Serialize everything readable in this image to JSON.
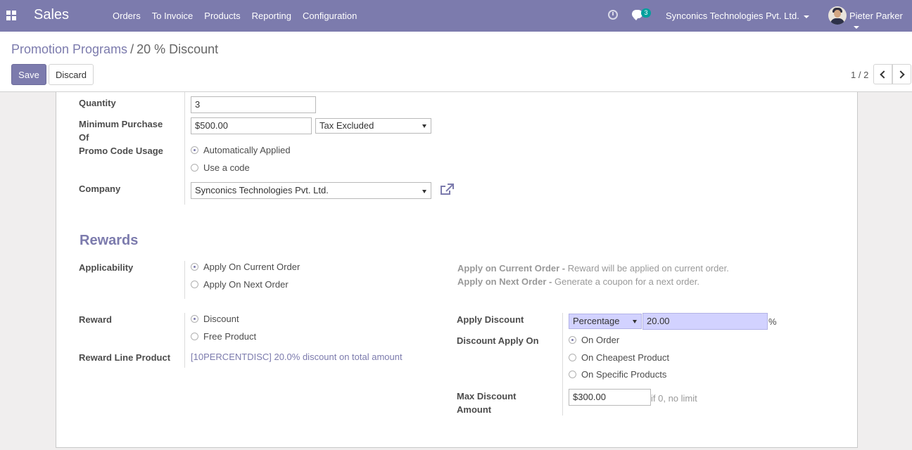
{
  "navbar": {
    "brand": "Sales",
    "menu": [
      "Orders",
      "To Invoice",
      "Products",
      "Reporting",
      "Configuration"
    ],
    "message_count": "3",
    "company": "Synconics Technologies Pvt. Ltd.",
    "user": "Pieter Parker"
  },
  "breadcrumb": {
    "parent": "Promotion Programs",
    "separator": "/",
    "current": "20 % Discount"
  },
  "toolbar": {
    "save_label": "Save",
    "discard_label": "Discard",
    "pager": "1 / 2"
  },
  "conditions": {
    "quantity_label": "Quantity",
    "quantity_value": "3",
    "min_purchase_label_1": "Minimum Purchase",
    "min_purchase_label_2": "Of",
    "min_purchase_value": "$500.00",
    "tax_mode": "Tax Excluded",
    "promo_usage_label": "Promo Code Usage",
    "promo_usage_options": [
      "Automatically Applied",
      "Use a code"
    ],
    "company_label": "Company",
    "company_value": "Synconics Technologies Pvt. Ltd."
  },
  "rewards": {
    "title": "Rewards",
    "applicability_label": "Applicability",
    "applicability_options": [
      "Apply On Current Order",
      "Apply On Next Order"
    ],
    "help_current_title": "Apply on Current Order -",
    "help_current_text": "Reward will be applied on current order.",
    "help_next_title": "Apply on Next Order -",
    "help_next_text": "Generate a coupon for a next order.",
    "reward_label": "Reward",
    "reward_options": [
      "Discount",
      "Free Product"
    ],
    "reward_line_label": "Reward Line Product",
    "reward_line_value": "[10PERCENTDISC] 20.0% discount on total amount",
    "apply_discount_label": "Apply Discount",
    "discount_type": "Percentage",
    "discount_value": "20.00",
    "discount_unit": "%",
    "discount_apply_on_label": "Discount Apply On",
    "discount_apply_on_options": [
      "On Order",
      "On Cheapest Product",
      "On Specific Products"
    ],
    "max_discount_label_1": "Max Discount",
    "max_discount_label_2": "Amount",
    "max_discount_value": "$300.00",
    "max_discount_hint": "if 0, no limit"
  },
  "colors": {
    "brand": "#7c7bad",
    "highlight_input": "#d2d2ff"
  }
}
